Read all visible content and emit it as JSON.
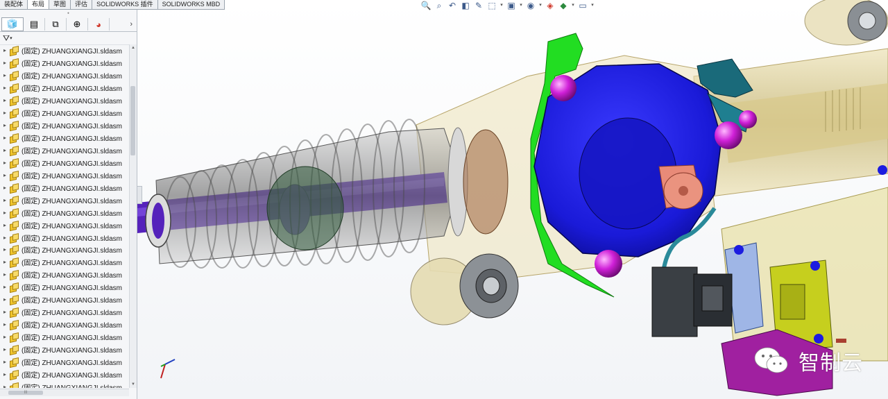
{
  "command_tabs": [
    "装配体",
    "布局",
    "草图",
    "评估",
    "SOLIDWORKS 插件",
    "SOLIDWORKS MBD"
  ],
  "active_tab_index": 1,
  "view_toolbar": [
    "zoom-to-fit-icon",
    "zoom-to-area-icon",
    "previous-view-icon",
    "section-view-icon",
    "dynamic-annotation-icon",
    "view-orientation-icon",
    "display-style-icon",
    "hide-show-items-icon",
    "edit-appearance-icon",
    "apply-scene-icon",
    "view-settings-icon"
  ],
  "panel": {
    "tab_icons": [
      "feature-manager-icon",
      "property-manager-icon",
      "configuration-manager-icon",
      "dimxpert-manager-icon",
      "display-manager-icon"
    ],
    "more_label": "›",
    "filter_icon": "filter-icon",
    "tree_items": [
      "(固定) ZHUANGXIANGJI.sldasm",
      "(固定) ZHUANGXIANGJI.sldasm",
      "(固定) ZHUANGXIANGJI.sldasm",
      "(固定) ZHUANGXIANGJI.sldasm",
      "(固定) ZHUANGXIANGJI.sldasm",
      "(固定) ZHUANGXIANGJI.sldasm",
      "(固定) ZHUANGXIANGJI.sldasm",
      "(固定) ZHUANGXIANGJI.sldasm",
      "(固定) ZHUANGXIANGJI.sldasm",
      "(固定) ZHUANGXIANGJI.sldasm",
      "(固定) ZHUANGXIANGJI.sldasm",
      "(固定) ZHUANGXIANGJI.sldasm",
      "(固定) ZHUANGXIANGJI.sldasm",
      "(固定) ZHUANGXIANGJI.sldasm",
      "(固定) ZHUANGXIANGJI.sldasm",
      "(固定) ZHUANGXIANGJI.sldasm",
      "(固定) ZHUANGXIANGJI.sldasm",
      "(固定) ZHUANGXIANGJI.sldasm",
      "(固定) ZHUANGXIANGJI.sldasm",
      "(固定) ZHUANGXIANGJI.sldasm",
      "(固定) ZHUANGXIANGJI.sldasm",
      "(固定) ZHUANGXIANGJI.sldasm",
      "(固定) ZHUANGXIANGJI.sldasm",
      "(固定) ZHUANGXIANGJI.sldasm",
      "(固定) ZHUANGXIANGJI.sldasm",
      "(固定) ZHUANGXIANGJI.sldasm",
      "(固定) ZHUANGXIANGJI.sldasm",
      "(固定) ZHUANGXIANGJI.sldasm"
    ]
  },
  "watermark": {
    "text": "智制云",
    "icon": "wechat-icon"
  },
  "colors": {
    "housing_translucent": "#e8dca8",
    "motor_blue": "#1a1ad8",
    "bracket_green": "#22dd22",
    "bolt_magenta": "#d020d8",
    "rack_purple": "#5522bb",
    "connector_magenta": "#a020a0",
    "shaft_salmon": "#e88a78"
  }
}
